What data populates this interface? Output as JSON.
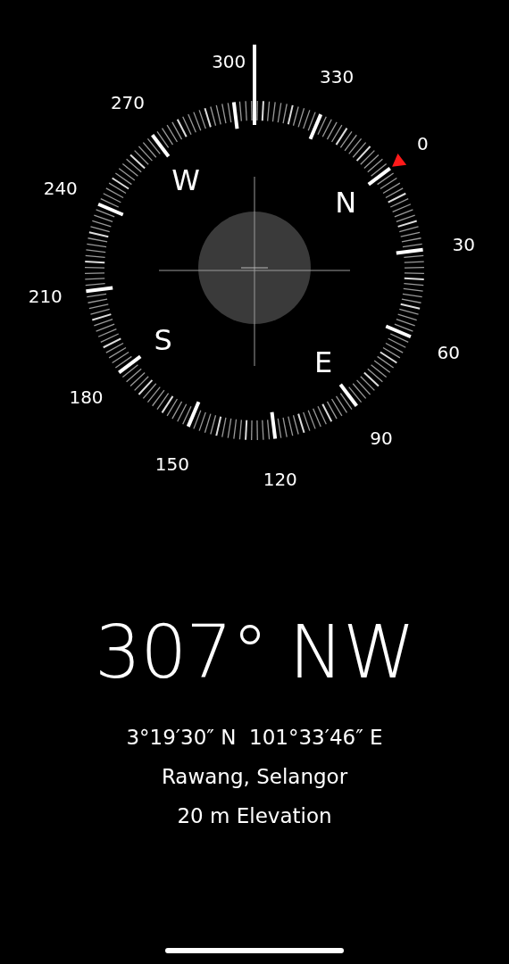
{
  "compass": {
    "degree_labels": [
      "0",
      "30",
      "60",
      "90",
      "120",
      "150",
      "180",
      "210",
      "240",
      "270",
      "300",
      "330"
    ],
    "cardinal_labels": [
      "N",
      "E",
      "S",
      "W"
    ]
  },
  "readout": {
    "heading": "307°",
    "direction": "NW"
  },
  "coordinates": "3°19′30″ N  101°33′46″ E",
  "place": "Rawang, Selangor",
  "elevation": "20 m Elevation"
}
